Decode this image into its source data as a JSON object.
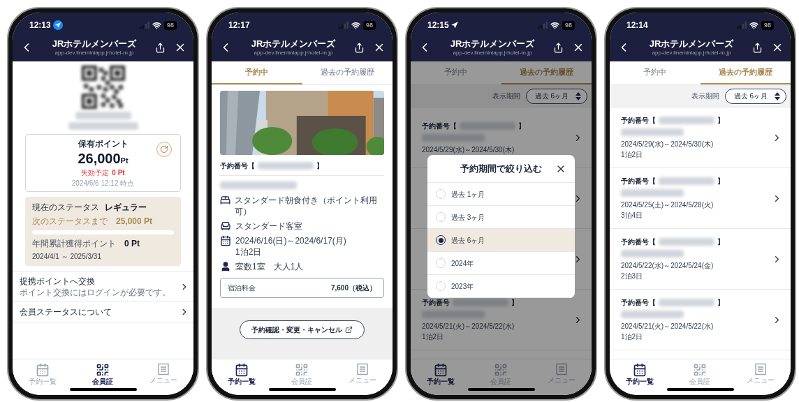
{
  "phones": [
    {
      "kind": "member_card",
      "status_bar": {
        "time": "12:13",
        "location": true,
        "location_badge": true,
        "battery": "98"
      },
      "header": {
        "title": "JRホテルメンバーズ",
        "url": "app-dev.lineminiapp.jrhotel-m.jp"
      },
      "points": {
        "title": "保有ポイント",
        "value": "26,000",
        "unit": "Pt",
        "expiry_label": "失効予定",
        "expiry_value": "0 Pt",
        "timestamp": "2024/6/6 12:12 時点"
      },
      "status": {
        "label": "現在のステータス",
        "rank": "レギュラー",
        "next_label": "次のステータスまで",
        "next_value": "25,000 Pt",
        "level": 0,
        "annual_label": "年間累計獲得ポイント",
        "annual_value": "0 Pt",
        "period": "2024/4/1 ～ 2025/3/31"
      },
      "menu": [
        {
          "title": "提携ポイントへ交換",
          "subtitle": "ポイント交換にはログインが必要です。"
        },
        {
          "title": "会員ステータスについて"
        }
      ],
      "nav": [
        {
          "kind": "calendar",
          "label": "予約一覧",
          "selected": false
        },
        {
          "kind": "qr",
          "label": "会員証",
          "selected": true
        },
        {
          "kind": "menu",
          "label": "メニュー",
          "selected": false
        }
      ]
    },
    {
      "kind": "reservation_detail",
      "status_bar": {
        "time": "12:17",
        "battery": "98"
      },
      "header": {
        "title": "JRホテルメンバーズ",
        "url": "app-dev.lineminiapp.jrhotel-m.jp"
      },
      "tabs": [
        {
          "label": "予約中",
          "selected": true
        },
        {
          "label": "過去の予約履歴",
          "selected": false
        }
      ],
      "reservation": {
        "number_label": "予約番号【",
        "number_end": "】",
        "details": [
          {
            "kind": "plan",
            "lines": [
              "スタンダード朝食付き（ポイント利用可）"
            ]
          },
          {
            "kind": "room",
            "lines": [
              "スタンダード客室"
            ]
          },
          {
            "kind": "dates",
            "lines": [
              "2024/6/16(日)～2024/6/17(月)",
              "1泊2日"
            ]
          },
          {
            "kind": "guests",
            "lines": [
              "室数1室　大人1人"
            ]
          }
        ],
        "price_label": "宿泊料金",
        "price_value": "7,600（税込）"
      },
      "action": "予約確認・変更・キャンセル",
      "nav": [
        {
          "kind": "calendar",
          "label": "予約一覧",
          "selected": true
        },
        {
          "kind": "qr",
          "label": "会員証",
          "selected": false
        },
        {
          "kind": "menu",
          "label": "メニュー",
          "selected": false
        }
      ]
    },
    {
      "kind": "history",
      "status_bar": {
        "time": "12:15",
        "location": true,
        "location_badge": false,
        "battery": "98"
      },
      "header": {
        "title": "JRホテルメンバーズ",
        "url": "app-dev.lineminiapp.jrhotel-m.jp"
      },
      "tabs": [
        {
          "label": "予約中",
          "selected": false
        },
        {
          "label": "過去の予約履歴",
          "selected": true
        }
      ],
      "filter": {
        "label": "表示期間",
        "value": "過去 6ヶ月"
      },
      "rows": [
        {
          "kind": "entry",
          "number_label": "予約番号【",
          "number_end": "】",
          "dates": "2024/5/29(水)～2024/5/30(木)"
        },
        {
          "kind": "covered"
        },
        {
          "kind": "covered"
        },
        {
          "kind": "entry",
          "number_label": "予約番号",
          "number_end": "】",
          "dates": "2024/5/21(火)～2024/5/22(水)",
          "stay": "1泊2日"
        }
      ],
      "modal": {
        "title": "予約期間で絞り込む",
        "options": [
          {
            "label": "過去 1ヶ月",
            "selected": false
          },
          {
            "label": "過去 3ヶ月",
            "selected": false
          },
          {
            "label": "過去 6ヶ月",
            "selected": true
          },
          {
            "label": "2024年",
            "selected": false
          },
          {
            "label": "2023年",
            "selected": false
          }
        ]
      },
      "nav": [
        {
          "kind": "calendar",
          "label": "予約一覧",
          "selected": true
        },
        {
          "kind": "qr",
          "label": "会員証",
          "selected": false
        },
        {
          "kind": "menu",
          "label": "メニュー",
          "selected": false
        }
      ]
    },
    {
      "kind": "history",
      "status_bar": {
        "time": "12:14",
        "battery": "98"
      },
      "header": {
        "title": "JRホテルメンバーズ",
        "url": "app-dev.lineminiapp.jrhotel-m.jp"
      },
      "tabs": [
        {
          "label": "予約中",
          "selected": false
        },
        {
          "label": "過去の予約履歴",
          "selected": true
        }
      ],
      "filter": {
        "label": "表示期間",
        "value": "過去 6ヶ月"
      },
      "rows": [
        {
          "kind": "entry",
          "number_label": "予約番号【",
          "number_end": "】",
          "dates": "2024/5/29(水)～2024/5/30(木)",
          "stay": "1泊2日"
        },
        {
          "kind": "entry",
          "number_label": "予約番号【",
          "number_end": "】",
          "dates": "2024/5/25(土)～2024/5/28(火)",
          "stay": "3泊4日"
        },
        {
          "kind": "entry",
          "number_label": "予約番号【",
          "number_end": "】",
          "dates": "2024/5/22(水)～2024/5/24(金)",
          "stay": "2泊3日"
        },
        {
          "kind": "entry",
          "number_label": "予約番号【",
          "number_end": "】",
          "dates": "2024/5/21(火)～2024/5/22(水)",
          "stay": "1泊2日"
        }
      ],
      "nav": [
        {
          "kind": "calendar",
          "label": "予約一覧",
          "selected": true
        },
        {
          "kind": "qr",
          "label": "会員証",
          "selected": false
        },
        {
          "kind": "menu",
          "label": "メニュー",
          "selected": false
        }
      ]
    }
  ]
}
